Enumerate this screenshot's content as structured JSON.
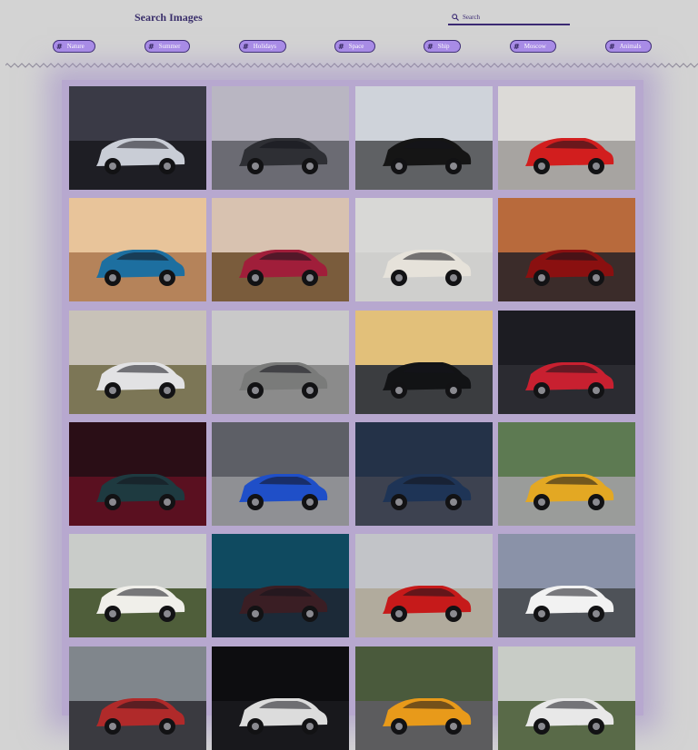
{
  "header": {
    "title": "Search Images",
    "search_placeholder": "Search",
    "search_value": "",
    "search_icon": "search-icon"
  },
  "tags": [
    {
      "label": "Nature"
    },
    {
      "label": "Summer"
    },
    {
      "label": "Holidays"
    },
    {
      "label": "Space"
    },
    {
      "label": "Ship"
    },
    {
      "label": "Moscow"
    },
    {
      "label": "Animals"
    }
  ],
  "gallery": {
    "tiles": [
      {
        "sky": "#3a3a46",
        "ground": "#1e1e24",
        "car": "#c9cdd6"
      },
      {
        "sky": "#b9b6c2",
        "ground": "#6b6b73",
        "car": "#2e2f34"
      },
      {
        "sky": "#cfd3da",
        "ground": "#5f6164",
        "car": "#151515"
      },
      {
        "sky": "#dcdad7",
        "ground": "#a7a4a1",
        "car": "#d21e1e"
      },
      {
        "sky": "#e8c49a",
        "ground": "#b5835a",
        "car": "#1d6fa0"
      },
      {
        "sky": "#d8c2b0",
        "ground": "#7a5c3c",
        "car": "#a01e3a"
      },
      {
        "sky": "#d8d8d6",
        "ground": "#cfcfcd",
        "car": "#e6e2da"
      },
      {
        "sky": "#b86a3c",
        "ground": "#3b2c2a",
        "car": "#8a1010"
      },
      {
        "sky": "#c8c2b8",
        "ground": "#7c7656",
        "car": "#e2e2e4"
      },
      {
        "sky": "#c9c9c9",
        "ground": "#8b8b8b",
        "car": "#7a7b7a"
      },
      {
        "sky": "#e2c07a",
        "ground": "#3b3d40",
        "car": "#121315"
      },
      {
        "sky": "#1c1c22",
        "ground": "#2b2b31",
        "car": "#c82030"
      },
      {
        "sky": "#2a0e16",
        "ground": "#5a1020",
        "car": "#1e3a40"
      },
      {
        "sky": "#5d5f66",
        "ground": "#8f9094",
        "car": "#1f4fc8"
      },
      {
        "sky": "#243248",
        "ground": "#3d4250",
        "car": "#1e3456"
      },
      {
        "sky": "#5d7a52",
        "ground": "#9a9c9a",
        "car": "#e3a823"
      },
      {
        "sky": "#c9ccc9",
        "ground": "#4f5e3a",
        "car": "#f0efea"
      },
      {
        "sky": "#0f4a60",
        "ground": "#1c2a38",
        "car": "#3a1e24"
      },
      {
        "sky": "#c2c4c8",
        "ground": "#b1ab9d",
        "car": "#c61a1a"
      },
      {
        "sky": "#8a92a8",
        "ground": "#4e5258",
        "car": "#f2f2f2"
      },
      {
        "sky": "#80868c",
        "ground": "#3a3a40",
        "car": "#b02a2a"
      },
      {
        "sky": "#0d0d10",
        "ground": "#18181c",
        "car": "#dcdcdc"
      },
      {
        "sky": "#4a5a3c",
        "ground": "#5c5c5e",
        "car": "#e89a1a"
      },
      {
        "sky": "#c8ccc6",
        "ground": "#596a48",
        "car": "#e8e8e8"
      }
    ]
  },
  "colors": {
    "accent": "#3b2a73",
    "tag_fill": "#a98ce8",
    "background": "#d3d3d3",
    "gallery_glow": "#b7a8cf"
  }
}
